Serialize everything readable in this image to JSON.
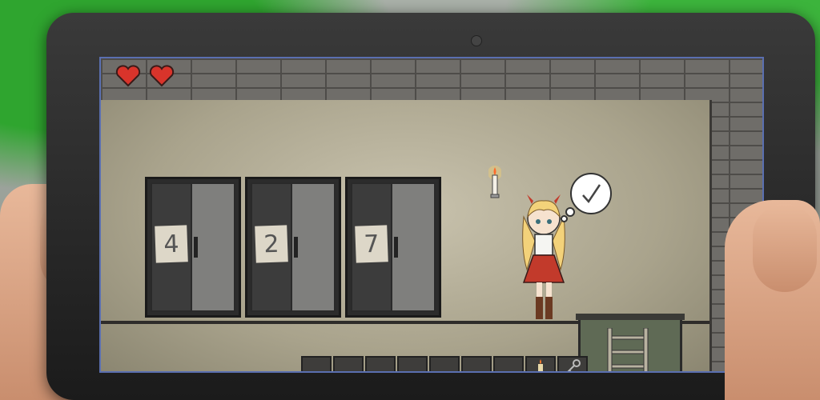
{
  "hud": {
    "lives": 2,
    "heart_color": "#d9342b"
  },
  "lockers": [
    {
      "number": "4"
    },
    {
      "number": "2"
    },
    {
      "number": "7"
    }
  ],
  "character": {
    "thought_icon": "checkmark-icon",
    "dress_color": "#c23a2b",
    "hair_color": "#f3d27a"
  },
  "inventory": {
    "slot_count": 9,
    "items": [
      "candle-item-icon",
      "key-item-icon"
    ]
  },
  "colors": {
    "wall": "#c2bca6",
    "brick": "#6f6d69"
  }
}
